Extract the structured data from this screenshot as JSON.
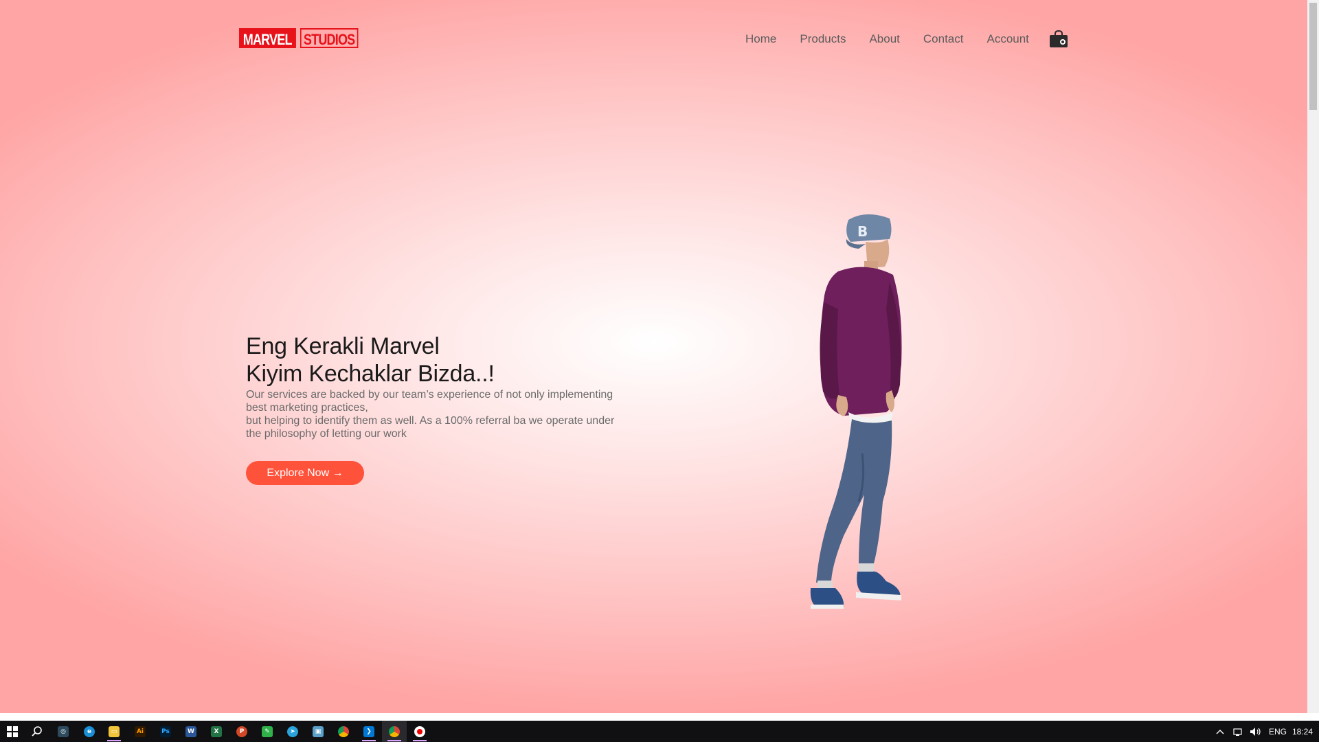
{
  "header": {
    "logo": {
      "part1": "MARVEL",
      "part2": "STUDIOS"
    },
    "nav": [
      {
        "label": "Home"
      },
      {
        "label": "Products"
      },
      {
        "label": "About"
      },
      {
        "label": "Contact"
      },
      {
        "label": "Account"
      }
    ],
    "cart_icon": "shopping-bag-icon"
  },
  "hero": {
    "title_line1": "Eng Kerakli Marvel",
    "title_line2": "Kiyim Kechaklar Bizda..!",
    "desc_line1": "Our services are backed by our team’s experience of not only implementing best marketing practices,",
    "desc_line2": "but helping to identify them as well. As a 100% referral ba we operate under the philosophy of letting our work",
    "button_label": "Explore Now →",
    "image": "person-walking-with-backpack"
  },
  "colors": {
    "accent": "#ff523b",
    "logo_red": "#e7121a",
    "bg_center": "#ffffff",
    "bg_edge": "#ffa5a5",
    "taskbar": "#101012"
  },
  "taskbar": {
    "apps": [
      "windows-start-icon",
      "search-icon",
      "davinci-icon",
      "edge-icon",
      "file-explorer-icon",
      "illustrator-icon",
      "photoshop-icon",
      "word-icon",
      "excel-icon",
      "powerpoint-icon",
      "android-app-icon",
      "telegram-icon",
      "app-icon",
      "chrome-icon",
      "vscode-icon",
      "chrome-active-icon",
      "recorder-icon"
    ],
    "tray": {
      "language": "ENG",
      "time": "18:24"
    }
  }
}
